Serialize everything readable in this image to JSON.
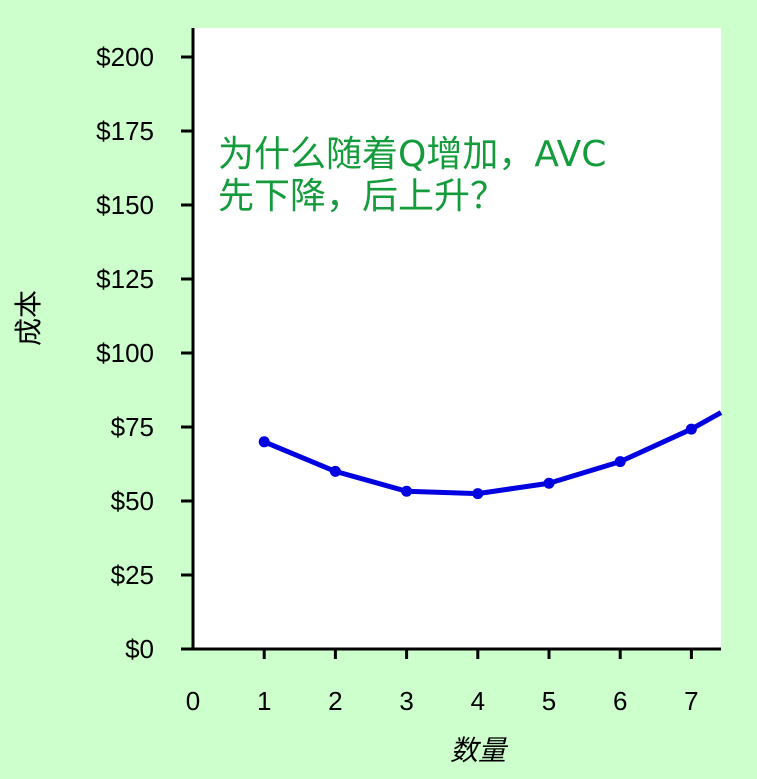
{
  "colors": {
    "background": "#ccffcc",
    "plot_area": "#ffffff",
    "series_line": "#0000e0",
    "annotation_text": "#149c3c",
    "axis": "#000000"
  },
  "chart_data": {
    "type": "line",
    "title": "",
    "xlabel": "数量",
    "ylabel": "成本",
    "x_ticks": [
      "0",
      "1",
      "2",
      "3",
      "4",
      "5",
      "6",
      "7"
    ],
    "y_ticks": [
      "$0",
      "$25",
      "$50",
      "$75",
      "$100",
      "$125",
      "$150",
      "$175",
      "$200"
    ],
    "xlim": [
      0,
      7.4
    ],
    "ylim": [
      0,
      200
    ],
    "grid": false,
    "series": [
      {
        "x": [
          1,
          2,
          3,
          4,
          5,
          6,
          7
        ],
        "y": [
          70,
          60,
          53.3,
          52.5,
          56,
          63.3,
          74.3
        ],
        "continues_past_axis": true
      }
    ],
    "annotation": {
      "lines": [
        "为什么随着Q增加，AVC",
        "先下降，后上升？"
      ]
    }
  }
}
